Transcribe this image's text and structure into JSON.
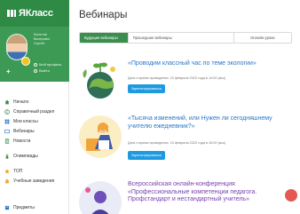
{
  "brand": {
    "logo_text": "ЯКласс"
  },
  "profile": {
    "name_lines": [
      "Когистов",
      "Валерович",
      "Сергей"
    ],
    "links": [
      "Мой профиль",
      "Выйти"
    ]
  },
  "sidebar": {
    "items": [
      {
        "label": "Начало",
        "icon": "home-icon",
        "color": "#3a8f4f"
      },
      {
        "label": "Справочный раздел",
        "icon": "info-icon",
        "color": "#3a8f4f"
      },
      {
        "label": "Мои классы",
        "icon": "grid-icon",
        "color": "#2a78c8"
      },
      {
        "label": "Вебинары",
        "icon": "webinar-icon",
        "color": "#2a78c8"
      },
      {
        "label": "Новости",
        "icon": "news-icon",
        "color": "#3a8f4f"
      },
      {
        "label": "Олимпиады",
        "icon": "medal-icon",
        "color": "#3a8f4f"
      },
      {
        "label": "ТОП",
        "icon": "star-icon",
        "color": "#f0a020"
      },
      {
        "label": "Учебные заведения",
        "icon": "school-icon",
        "color": "#f0a020"
      },
      {
        "label": "Предметы",
        "icon": "book-icon",
        "color": "#2a78c8"
      }
    ]
  },
  "main": {
    "title": "Вебинары",
    "tabs": [
      "Будущие вебинары",
      "Прошедшие вебинары",
      "Онлайн-уроки"
    ],
    "cards": [
      {
        "title": "«Проводим классный час по теме экологии»",
        "meta": "Дата и время проведения: 22 февраля 2022 года в 14:00 (мск)",
        "button": "Зарегистрироваться"
      },
      {
        "title": "«Тысяча изменений, или Нужен ли сегодняшнему учителю ежедневник?»",
        "meta": "Дата и время проведения: 23 февраля 2022 года в 16:00 (мск)",
        "button": "Зарегистрироваться"
      },
      {
        "title": "Всероссийская онлайн-конференция «Профессиональные компетенции педагога. Профстандарт и нестандартный учитель»",
        "meta": "",
        "button": ""
      }
    ]
  },
  "colors": {
    "brand_green": "#2f8a46",
    "accent_blue": "#1e9be0",
    "link_blue": "#2a78c8"
  }
}
